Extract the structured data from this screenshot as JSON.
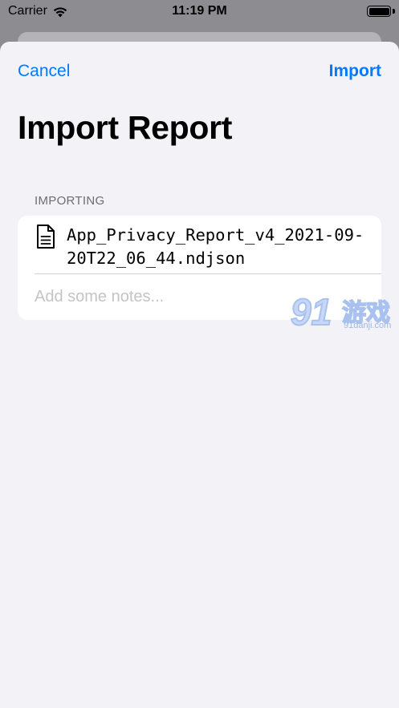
{
  "status_bar": {
    "carrier": "Carrier",
    "time": "11:19 PM"
  },
  "nav": {
    "cancel_label": "Cancel",
    "import_label": "Import"
  },
  "title": "Import Report",
  "section": {
    "header": "IMPORTING",
    "file_name": "App_Privacy_Report_v4_2021-09-20T22_06_44.ndjson",
    "notes_placeholder": "Add some notes..."
  },
  "watermark": {
    "mark": "91",
    "label": "游戏",
    "url": "91danji.com"
  },
  "colors": {
    "accent": "#007aff",
    "background": "#f2f2f7",
    "card": "#ffffff",
    "secondary_text": "#6d6d72",
    "placeholder": "#c4c4c7"
  },
  "icons": [
    "wifi-icon",
    "battery-icon",
    "document-icon"
  ]
}
